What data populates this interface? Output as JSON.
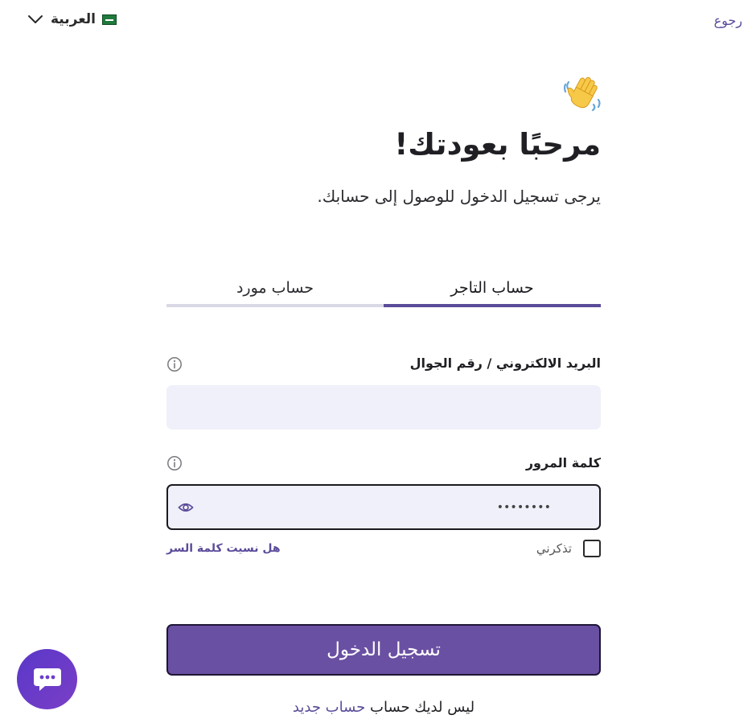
{
  "header": {
    "back_label": "رجوع",
    "language_label": "العربية"
  },
  "welcome": {
    "title": "مرحبًا بعودتك!",
    "subtitle": "يرجى تسجيل الدخول للوصول إلى حسابك."
  },
  "tabs": [
    {
      "label": "حساب التاجر",
      "active": true
    },
    {
      "label": "حساب مورد",
      "active": false
    }
  ],
  "form": {
    "email_label": "البريد الالكتروني / رقم الجوال",
    "email_value": "",
    "password_label": "كلمة المرور",
    "password_value": "••••••••",
    "remember_label": "تذكرني",
    "forgot_label": "هل نسيت كلمة السر",
    "submit_label": "تسجيل الدخول"
  },
  "signup": {
    "prompt": "ليس لديك حساب",
    "link_label": "حساب جديد"
  },
  "colors": {
    "accent": "#6a50a3",
    "link": "#5b4b9a",
    "input_bg": "#eff0f9",
    "tab_inactive": "#d9d9e6"
  },
  "icons": {
    "language_chevron": "chevron-down-icon",
    "flag": "saudi-flag-icon",
    "wave": "waving-hand-icon",
    "info": "info-icon",
    "eye": "eye-icon",
    "chat": "chat-icon"
  }
}
